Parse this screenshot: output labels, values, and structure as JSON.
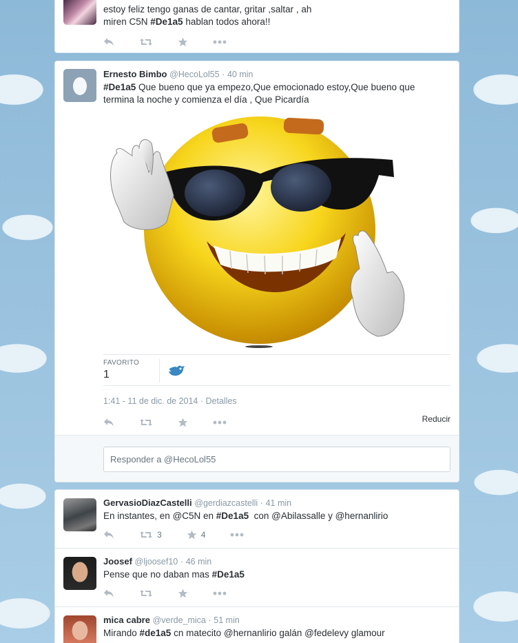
{
  "tweets": [
    {
      "text_line1": "estoy feliz tengo ganas de cantar, gritar ,saltar , ah",
      "text_line2_pre": "miren C5N ",
      "hashtag": "#De1a5",
      "text_line2_post": " hablan todos ahora!!"
    },
    {
      "fullname": "Ernesto Bimbo",
      "username": "@HecoLol55",
      "dot": "·",
      "time": "40 min",
      "hashtag": "#De1a5",
      "text_line1_post": " Que bueno que ya empezo,Que emocionado estoy,Que bueno que",
      "text_line2": "termina la noche y comienza el día , Que Picardía",
      "favorites_label": "FAVORITO",
      "favorites_count": "1",
      "timestamp": "1:41 - 11 de dic. de 2014",
      "sep": "·",
      "details": "Detalles",
      "collapse": "Reducir",
      "reply_placeholder": "Responder a @HecoLol55"
    },
    {
      "fullname": "GervasioDiazCastelli",
      "username": "@gerdiazcastelli",
      "dot": "·",
      "time": "41 min",
      "text_pre": "En instantes, en @C5N en ",
      "hashtag": "#De1a5",
      "text_post": "  con @Abilassalle y @hernanlirio",
      "retweets": "3",
      "favorites": "4"
    },
    {
      "fullname": "Joosef",
      "username": "@ljoosef10",
      "dot": "·",
      "time": "46 min",
      "text_pre": "Pense que no daban mas ",
      "hashtag": "#De1a5"
    },
    {
      "fullname": "mica cabre",
      "username": "@verde_mica",
      "dot": "·",
      "time": "51 min",
      "text_pre": "Mirando ",
      "hashtag": "#de1a5",
      "text_post": " cn matecito @hernanlirio galán @fedelevy glamour"
    }
  ],
  "colors": {
    "link": "#0084b4",
    "action": "#a8b3bc",
    "text": "#292f33",
    "meta": "#8899a6"
  },
  "icons": [
    "reply-icon",
    "retweet-icon",
    "favorite-icon",
    "more-icon",
    "twitter-bird-icon",
    "egg-avatar-icon"
  ]
}
